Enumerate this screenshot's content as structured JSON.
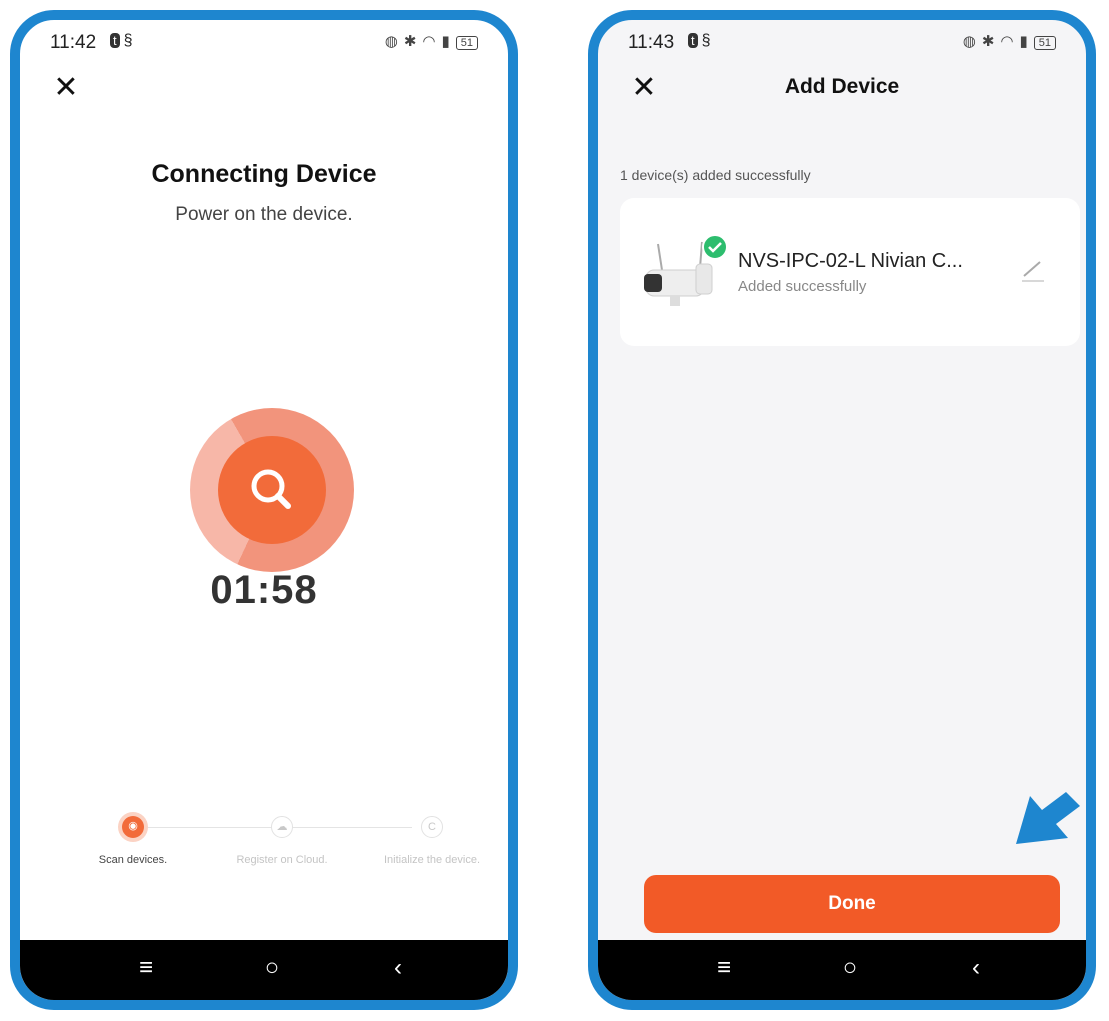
{
  "left_screen": {
    "status": {
      "time": "11:42",
      "battery": "51"
    },
    "title": "Connecting Device",
    "subtitle": "Power on the device.",
    "timer": "01:58",
    "steps": [
      {
        "label": "Scan devices.",
        "state": "active"
      },
      {
        "label": "Register on Cloud.",
        "state": "pending"
      },
      {
        "label": "Initialize the device.",
        "state": "pending"
      }
    ]
  },
  "right_screen": {
    "status": {
      "time": "11:43",
      "battery": "51"
    },
    "title": "Add Device",
    "added_count_text": "1 device(s) added successfully",
    "device": {
      "name": "NVS-IPC-02-L Nivian C...",
      "status": "Added successfully"
    },
    "done_label": "Done"
  },
  "icons": [
    "close-icon",
    "search-icon",
    "check-icon",
    "edit-icon",
    "menu-icon",
    "home-icon",
    "back-icon",
    "arrow-icon"
  ],
  "colors": {
    "accent": "#f25a27",
    "frame": "#1e86cf",
    "success": "#2dbd6e"
  }
}
